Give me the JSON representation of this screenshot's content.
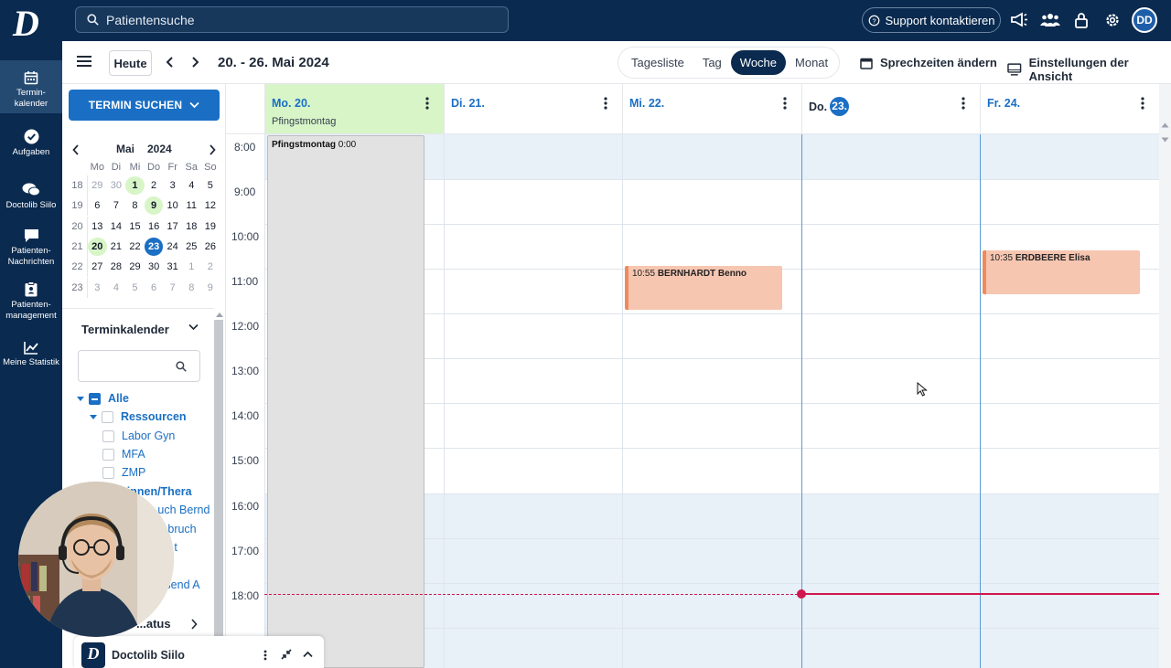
{
  "topbar": {
    "search_placeholder": "Patientensuche",
    "support_label": "Support kontaktieren",
    "avatar_initials": "DD"
  },
  "leftnav": {
    "items": [
      {
        "label1": "Termin-",
        "label2": "kalender"
      },
      {
        "label1": "Aufgaben",
        "label2": ""
      },
      {
        "label1": "Doctolib Siilo",
        "label2": ""
      },
      {
        "label1": "Patienten-",
        "label2": "Nachrichten"
      },
      {
        "label1": "Patienten-",
        "label2": "management"
      },
      {
        "label1": "Meine Statistik",
        "label2": ""
      }
    ]
  },
  "toolbar": {
    "today_label": "Heute",
    "date_range": "20. - 26. Mai 2024",
    "views": [
      "Tagesliste",
      "Tag",
      "Woche",
      "Monat"
    ],
    "active_view": "Woche",
    "office_hours_label": "Sprechzeiten ändern",
    "view_settings_label": "Einstellungen der Ansicht"
  },
  "sidepanel": {
    "search_button": "TERMIN SUCHEN",
    "mini_month": "Mai",
    "mini_year": "2024",
    "weekdays": [
      "Mo",
      "Di",
      "Mi",
      "Do",
      "Fr",
      "Sa",
      "So"
    ],
    "weeks": [
      {
        "wk": "18",
        "days": [
          "29",
          "30",
          "1",
          "2",
          "3",
          "4",
          "5"
        ]
      },
      {
        "wk": "19",
        "days": [
          "6",
          "7",
          "8",
          "9",
          "10",
          "11",
          "12"
        ]
      },
      {
        "wk": "20",
        "days": [
          "13",
          "14",
          "15",
          "16",
          "17",
          "18",
          "19"
        ]
      },
      {
        "wk": "21",
        "days": [
          "20",
          "21",
          "22",
          "23",
          "24",
          "25",
          "26"
        ]
      },
      {
        "wk": "22",
        "days": [
          "27",
          "28",
          "29",
          "30",
          "31",
          "1",
          "2"
        ]
      },
      {
        "wk": "23",
        "days": [
          "3",
          "4",
          "5",
          "6",
          "7",
          "8",
          "9"
        ]
      }
    ],
    "calendar_section": "Terminkalender",
    "tree": {
      "all": "Alle",
      "resources": "Ressourcen",
      "resource_items": [
        "Labor Gyn",
        "MFA",
        "ZMP"
      ],
      "doctors_partial": "...t:innen/Thera",
      "doctor1_partial": "...uch Bernd",
      "doctor2_partial": "...nbruch",
      "doctor3_partial": "...t",
      "doctor4_partial": "...send A"
    },
    "status_section": "...atus"
  },
  "calendar": {
    "days": [
      {
        "label": "Mo. 20.",
        "sub": "Pfingstmontag"
      },
      {
        "label": "Di. 21.",
        "sub": ""
      },
      {
        "label": "Mi. 22.",
        "sub": ""
      },
      {
        "label": "Do.",
        "today_num": "23.",
        "sub": ""
      },
      {
        "label": "Fr. 24.",
        "sub": ""
      }
    ],
    "hours": [
      "8:00",
      "9:00",
      "10:00",
      "11:00",
      "12:00",
      "13:00",
      "14:00",
      "15:00",
      "16:00",
      "17:00",
      "18:00"
    ],
    "holiday_event": {
      "title": "Pfingstmontag",
      "time": "0:00"
    },
    "appointments": [
      {
        "time": "10:55",
        "name": "BERNHARDT Benno"
      },
      {
        "time": "10:35",
        "name": "ERDBEERE Elisa"
      }
    ]
  },
  "siilo": {
    "title": "Doctolib Siilo"
  },
  "colors": {
    "brand_dark": "#0a2a4f",
    "accent": "#1a6fc4",
    "now_line": "#d1174f",
    "appointment": "#f6c6b1"
  }
}
